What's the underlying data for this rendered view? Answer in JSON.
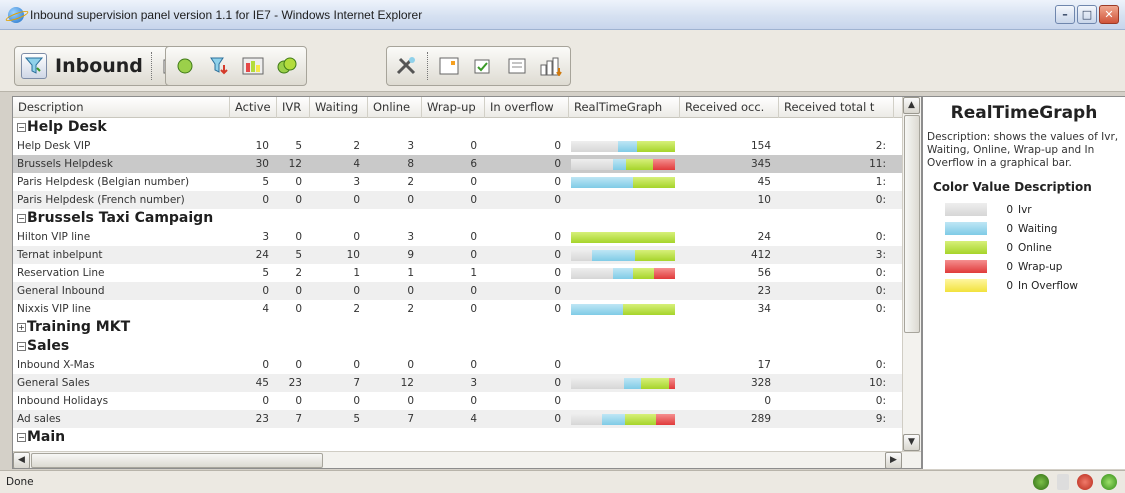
{
  "window": {
    "title": "Inbound supervision panel version 1.1 for IE7 - Windows Internet Explorer"
  },
  "toolbar": {
    "label": "Inbound"
  },
  "grid": {
    "columns": [
      {
        "label": "Description",
        "w": 217
      },
      {
        "label": "Active",
        "w": 47
      },
      {
        "label": "IVR",
        "w": 33
      },
      {
        "label": "Waiting",
        "w": 58
      },
      {
        "label": "Online",
        "w": 54
      },
      {
        "label": "Wrap-up",
        "w": 63
      },
      {
        "label": "In overflow",
        "w": 84
      },
      {
        "label": "RealTimeGraph",
        "w": 111
      },
      {
        "label": "Received occ.",
        "w": 99
      },
      {
        "label": "Received total t",
        "w": 115
      }
    ],
    "groups": [
      {
        "name": "Help Desk",
        "expanded": true,
        "rows": [
          {
            "desc": "Help Desk VIP",
            "active": "10",
            "ivr": "5",
            "waiting": "2",
            "online": "3",
            "wrap": "0",
            "overflow": "0",
            "received": "154",
            "total": "2:",
            "bar": [
              [
                "ivr",
                0.45
              ],
              [
                "wait",
                0.18
              ],
              [
                "on",
                0.37
              ]
            ]
          },
          {
            "desc": "Brussels Helpdesk",
            "active": "30",
            "ivr": "12",
            "waiting": "4",
            "online": "8",
            "wrap": "6",
            "overflow": "0",
            "received": "345",
            "total": "11:",
            "bar": [
              [
                "ivr",
                0.4
              ],
              [
                "wait",
                0.13
              ],
              [
                "on",
                0.26
              ],
              [
                "wrap",
                0.21
              ]
            ],
            "selected": true
          },
          {
            "desc": "Paris Helpdesk (Belgian number)",
            "active": "5",
            "ivr": "0",
            "waiting": "3",
            "online": "2",
            "wrap": "0",
            "overflow": "0",
            "received": "45",
            "total": "1:",
            "bar": [
              [
                "wait",
                0.6
              ],
              [
                "on",
                0.4
              ]
            ]
          },
          {
            "desc": "Paris Helpdesk (French number)",
            "active": "0",
            "ivr": "0",
            "waiting": "0",
            "online": "0",
            "wrap": "0",
            "overflow": "0",
            "received": "10",
            "total": "0:",
            "bar": []
          }
        ]
      },
      {
        "name": "Brussels Taxi Campaign",
        "expanded": true,
        "rows": [
          {
            "desc": "Hilton VIP line",
            "active": "3",
            "ivr": "0",
            "waiting": "0",
            "online": "3",
            "wrap": "0",
            "overflow": "0",
            "received": "24",
            "total": "0:",
            "bar": [
              [
                "on",
                1.0
              ]
            ]
          },
          {
            "desc": "Ternat inbelpunt",
            "active": "24",
            "ivr": "5",
            "waiting": "10",
            "online": "9",
            "wrap": "0",
            "overflow": "0",
            "received": "412",
            "total": "3:",
            "bar": [
              [
                "ivr",
                0.2
              ],
              [
                "wait",
                0.42
              ],
              [
                "on",
                0.38
              ]
            ]
          },
          {
            "desc": "Reservation Line",
            "active": "5",
            "ivr": "2",
            "waiting": "1",
            "online": "1",
            "wrap": "1",
            "overflow": "0",
            "received": "56",
            "total": "0:",
            "bar": [
              [
                "ivr",
                0.4
              ],
              [
                "wait",
                0.2
              ],
              [
                "on",
                0.2
              ],
              [
                "wrap",
                0.2
              ]
            ]
          },
          {
            "desc": "General Inbound",
            "active": "0",
            "ivr": "0",
            "waiting": "0",
            "online": "0",
            "wrap": "0",
            "overflow": "0",
            "received": "23",
            "total": "0:",
            "bar": []
          },
          {
            "desc": "Nixxis VIP line",
            "active": "4",
            "ivr": "0",
            "waiting": "2",
            "online": "2",
            "wrap": "0",
            "overflow": "0",
            "received": "34",
            "total": "0:",
            "bar": [
              [
                "wait",
                0.5
              ],
              [
                "on",
                0.5
              ]
            ]
          }
        ]
      },
      {
        "name": "Training MKT",
        "expanded": false,
        "rows": []
      },
      {
        "name": "Sales",
        "expanded": true,
        "rows": [
          {
            "desc": "Inbound X-Mas",
            "active": "0",
            "ivr": "0",
            "waiting": "0",
            "online": "0",
            "wrap": "0",
            "overflow": "0",
            "received": "17",
            "total": "0:",
            "bar": []
          },
          {
            "desc": "General Sales",
            "active": "45",
            "ivr": "23",
            "waiting": "7",
            "online": "12",
            "wrap": "3",
            "overflow": "0",
            "received": "328",
            "total": "10:",
            "bar": [
              [
                "ivr",
                0.51
              ],
              [
                "wait",
                0.16
              ],
              [
                "on",
                0.27
              ],
              [
                "wrap",
                0.06
              ]
            ]
          },
          {
            "desc": "Inbound Holidays",
            "active": "0",
            "ivr": "0",
            "waiting": "0",
            "online": "0",
            "wrap": "0",
            "overflow": "0",
            "received": "0",
            "total": "0:",
            "bar": []
          },
          {
            "desc": "Ad sales",
            "active": "23",
            "ivr": "7",
            "waiting": "5",
            "online": "7",
            "wrap": "4",
            "overflow": "0",
            "received": "289",
            "total": "9:",
            "bar": [
              [
                "ivr",
                0.3
              ],
              [
                "wait",
                0.22
              ],
              [
                "on",
                0.3
              ],
              [
                "wrap",
                0.18
              ]
            ]
          }
        ]
      },
      {
        "name": "Main",
        "expanded": true,
        "rows": []
      }
    ]
  },
  "panel": {
    "title": "RealTimeGraph",
    "description": "Description: shows the values of Ivr, Waiting, Online, Wrap-up and In Overflow in a graphical bar.",
    "heading": "Color Value Description",
    "legend": [
      {
        "key": "ivr",
        "value": "0",
        "label": "Ivr"
      },
      {
        "key": "wait",
        "value": "0",
        "label": "Waiting"
      },
      {
        "key": "on",
        "value": "0",
        "label": "Online"
      },
      {
        "key": "wrap",
        "value": "0",
        "label": "Wrap-up"
      },
      {
        "key": "ovr",
        "value": "0",
        "label": "In Overflow"
      }
    ]
  },
  "status": {
    "text": "Done"
  },
  "colors": {
    "ivr": "#dcdcdc",
    "wait": "#8fd1ea",
    "on": "#b3dc3c",
    "wrap": "#e54848",
    "ovr": "#f6e84c"
  }
}
